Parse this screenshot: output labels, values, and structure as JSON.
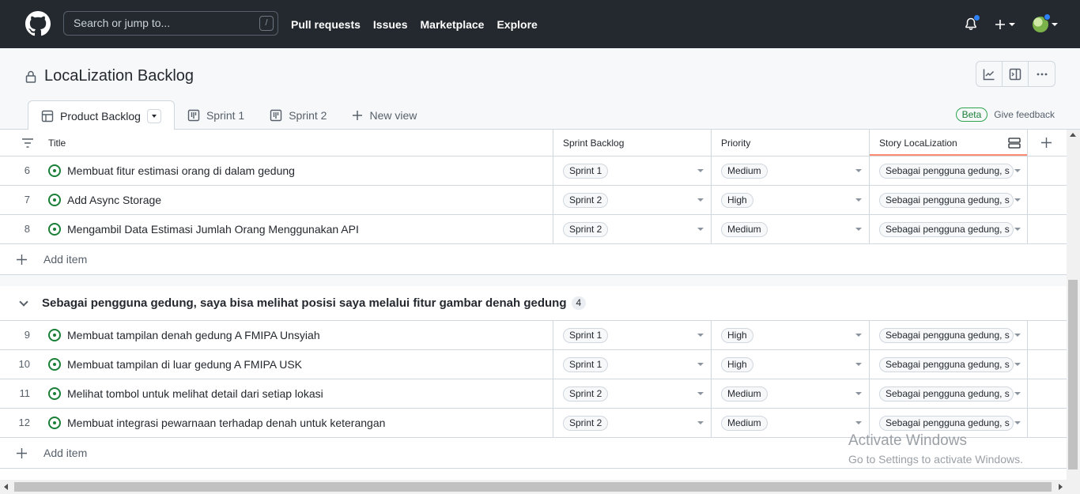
{
  "header": {
    "search_placeholder": "Search or jump to...",
    "search_shortcut": "/",
    "nav": [
      "Pull requests",
      "Issues",
      "Marketplace",
      "Explore"
    ]
  },
  "project": {
    "title": "LocaLization Backlog",
    "views": [
      "Product Backlog",
      "Sprint 1",
      "Sprint 2",
      "New view"
    ],
    "beta_label": "Beta",
    "feedback_label": "Give feedback"
  },
  "table": {
    "columns": [
      "Title",
      "Sprint Backlog",
      "Priority",
      "Story LocaLization"
    ],
    "group1_rows": [
      {
        "num": "6",
        "title": "Membuat fitur estimasi orang di dalam gedung",
        "sprint": "Sprint 1",
        "priority": "Medium",
        "story": "Sebagai pengguna gedung, s"
      },
      {
        "num": "7",
        "title": "Add Async Storage",
        "sprint": "Sprint 2",
        "priority": "High",
        "story": "Sebagai pengguna gedung, s"
      },
      {
        "num": "8",
        "title": "Mengambil Data Estimasi Jumlah Orang Menggunakan API",
        "sprint": "Sprint 2",
        "priority": "Medium",
        "story": "Sebagai pengguna gedung, s"
      }
    ],
    "add_item_label": "Add item",
    "group2": {
      "title": "Sebagai pengguna gedung, saya bisa melihat posisi saya melalui fitur gambar denah gedung",
      "count": "4"
    },
    "group2_rows": [
      {
        "num": "9",
        "title": "Membuat tampilan denah gedung A FMIPA Unsyiah",
        "sprint": "Sprint 1",
        "priority": "High",
        "story": "Sebagai pengguna gedung, s"
      },
      {
        "num": "10",
        "title": "Membuat tampilan di luar gedung A FMIPA USK",
        "sprint": "Sprint 1",
        "priority": "High",
        "story": "Sebagai pengguna gedung, s"
      },
      {
        "num": "11",
        "title": "Melihat tombol untuk melihat detail dari setiap lokasi",
        "sprint": "Sprint 2",
        "priority": "Medium",
        "story": "Sebagai pengguna gedung, s"
      },
      {
        "num": "12",
        "title": "Membuat integrasi pewarnaan terhadap denah untuk keterangan",
        "sprint": "Sprint 2",
        "priority": "Medium",
        "story": "Sebagai pengguna gedung, s"
      }
    ]
  },
  "watermark": {
    "line1": "Activate Windows",
    "line2": "Go to Settings to activate Windows."
  }
}
